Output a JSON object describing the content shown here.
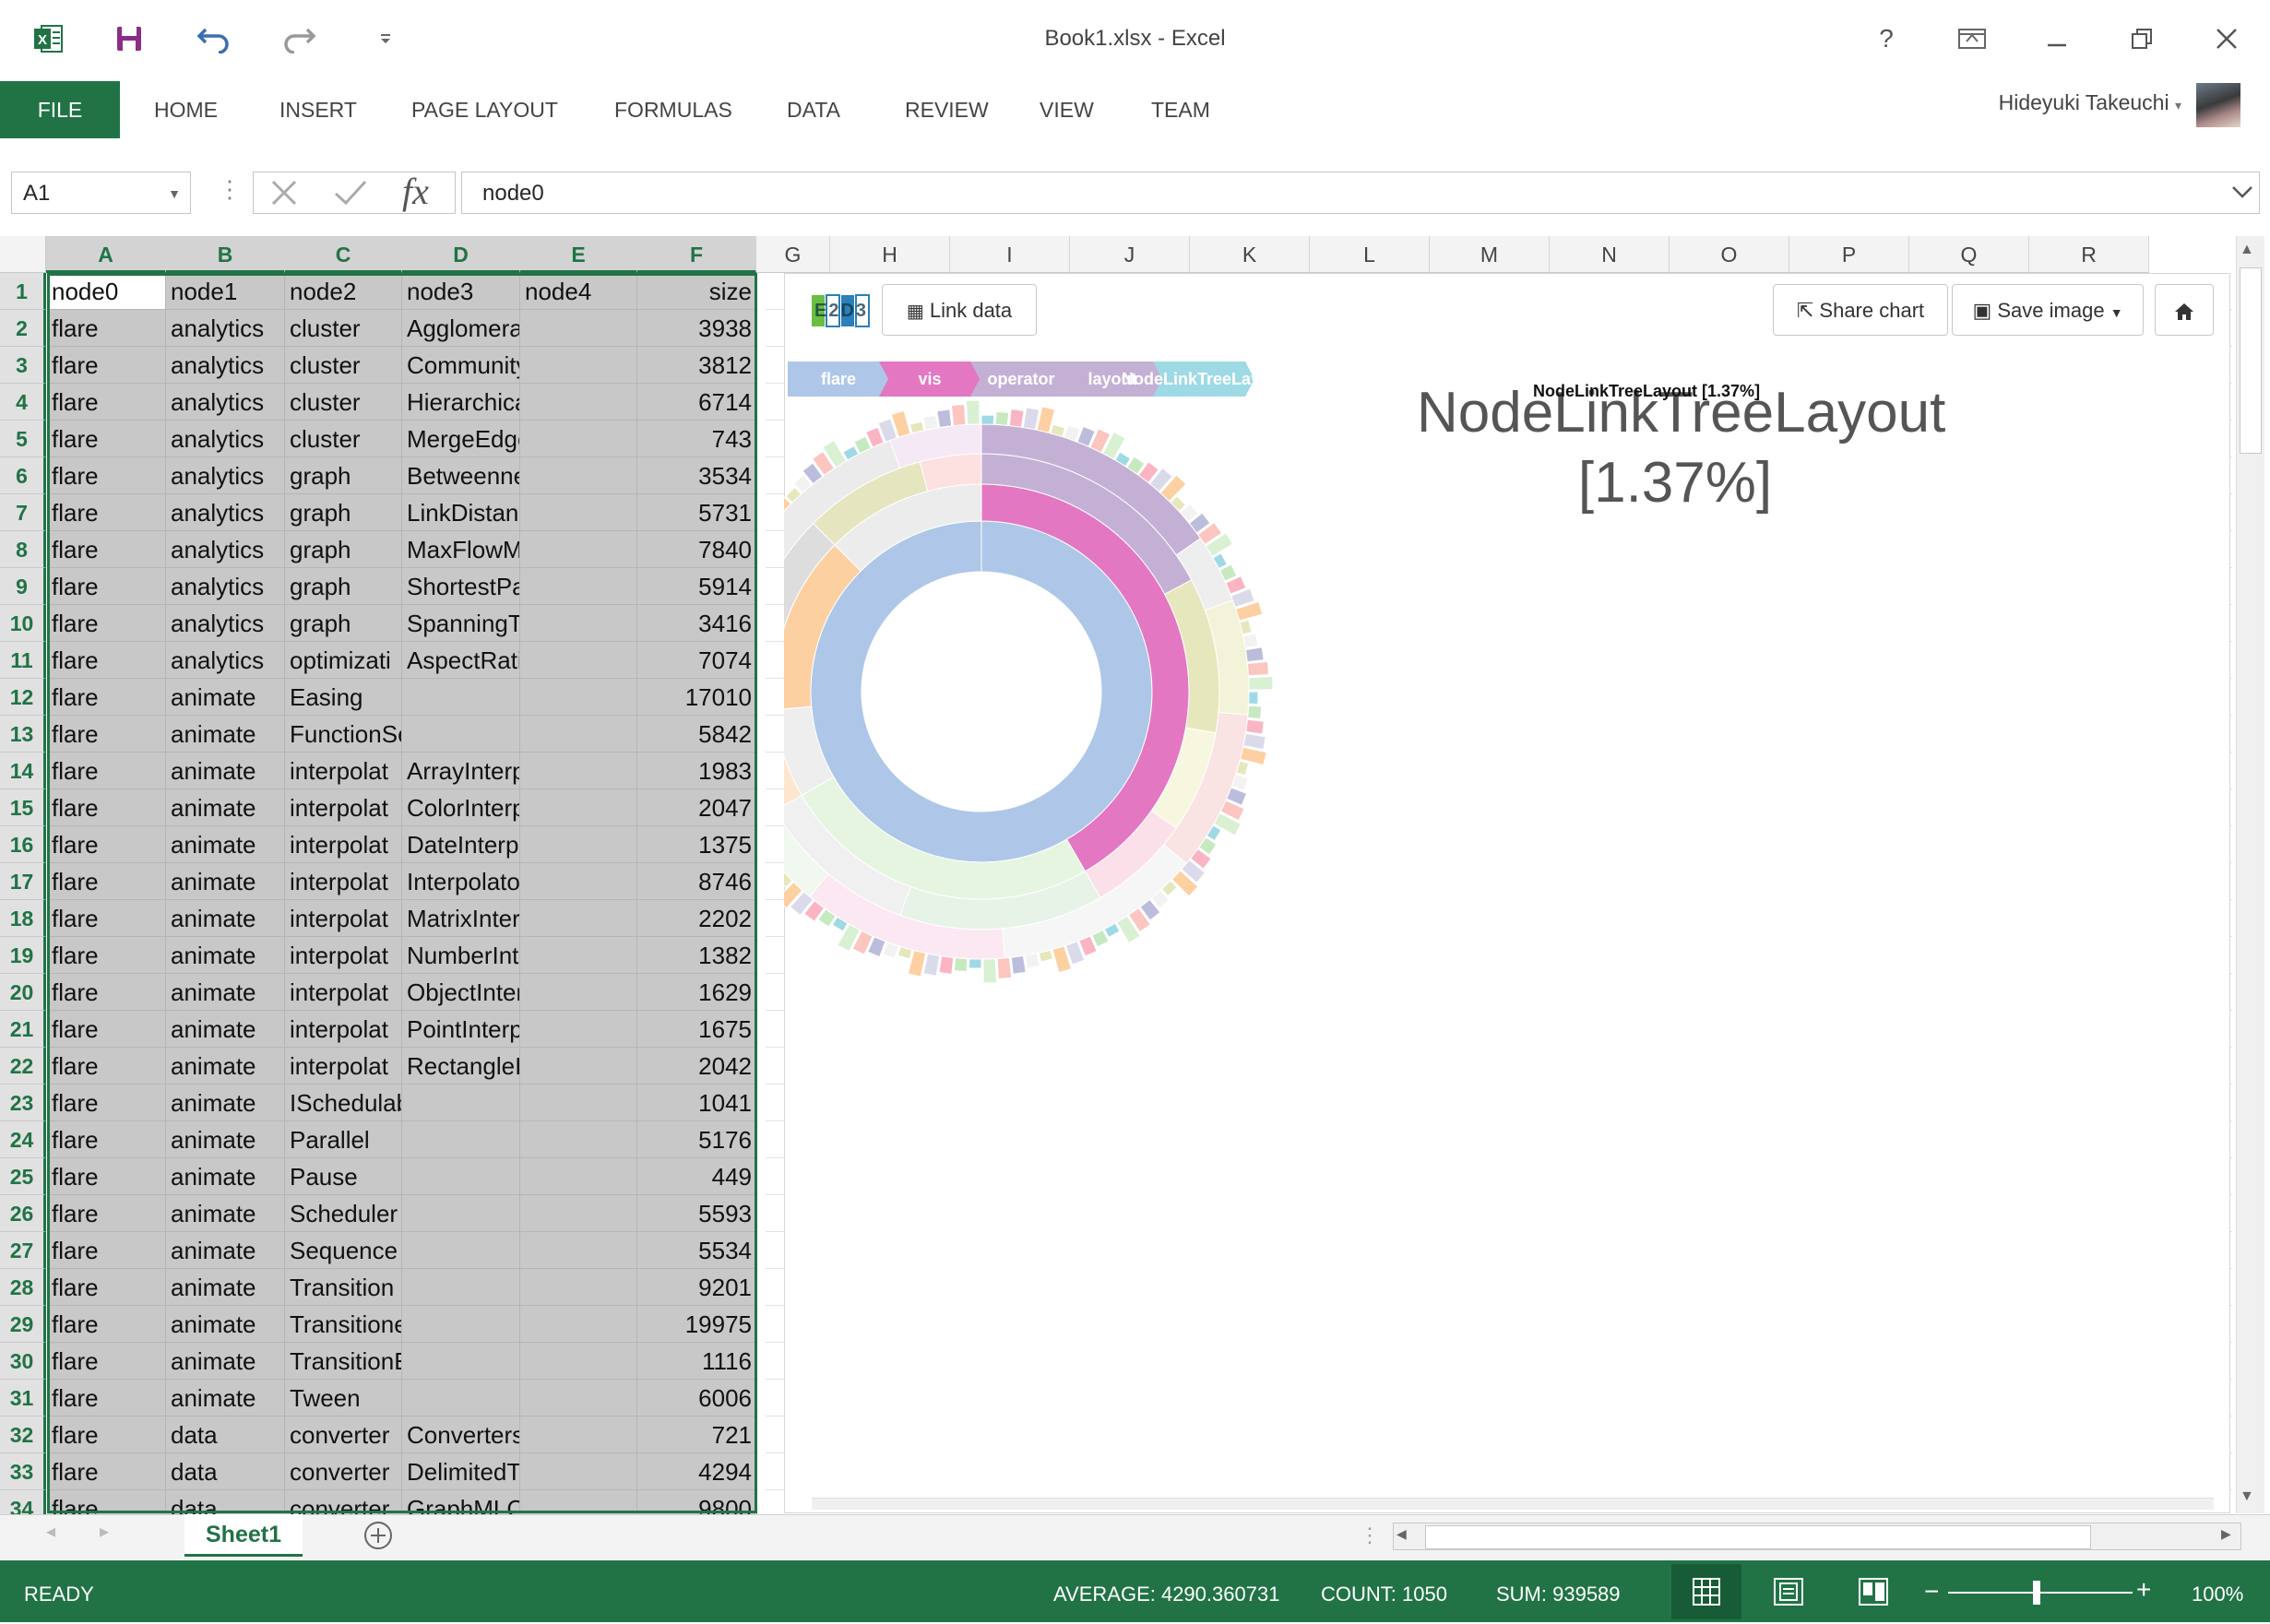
{
  "window": {
    "title": "Book1.xlsx - Excel",
    "user": "Hideyuki Takeuchi",
    "help": "?"
  },
  "ribbon": {
    "tabs": [
      "FILE",
      "HOME",
      "INSERT",
      "PAGE LAYOUT",
      "FORMULAS",
      "DATA",
      "REVIEW",
      "VIEW",
      "TEAM"
    ]
  },
  "formula_bar": {
    "name_box": "A1",
    "value": "node0"
  },
  "columns": [
    "A",
    "B",
    "C",
    "D",
    "E",
    "F",
    "G",
    "H",
    "I",
    "J",
    "K",
    "L",
    "M",
    "N",
    "O",
    "P",
    "Q",
    "R"
  ],
  "rows": [
    {
      "n": "1",
      "a": "node0",
      "b": "node1",
      "c": "node2",
      "d": "node3",
      "e": "node4",
      "f": "size"
    },
    {
      "n": "2",
      "a": "flare",
      "b": "analytics",
      "c": "cluster",
      "d": "AgglomerativeCluste",
      "e": "",
      "f": "3938"
    },
    {
      "n": "3",
      "a": "flare",
      "b": "analytics",
      "c": "cluster",
      "d": "CommunityStructure",
      "e": "",
      "f": "3812"
    },
    {
      "n": "4",
      "a": "flare",
      "b": "analytics",
      "c": "cluster",
      "d": "HierarchicalCluster",
      "e": "",
      "f": "6714"
    },
    {
      "n": "5",
      "a": "flare",
      "b": "analytics",
      "c": "cluster",
      "d": "MergeEdge",
      "e": "",
      "f": "743"
    },
    {
      "n": "6",
      "a": "flare",
      "b": "analytics",
      "c": "graph",
      "d": "BetweennessCentra",
      "e": "",
      "f": "3534"
    },
    {
      "n": "7",
      "a": "flare",
      "b": "analytics",
      "c": "graph",
      "d": "LinkDistance",
      "e": "",
      "f": "5731"
    },
    {
      "n": "8",
      "a": "flare",
      "b": "analytics",
      "c": "graph",
      "d": "MaxFlowMinCut",
      "e": "",
      "f": "7840"
    },
    {
      "n": "9",
      "a": "flare",
      "b": "analytics",
      "c": "graph",
      "d": "ShortestPaths",
      "e": "",
      "f": "5914"
    },
    {
      "n": "10",
      "a": "flare",
      "b": "analytics",
      "c": "graph",
      "d": "SpanningTree",
      "e": "",
      "f": "3416"
    },
    {
      "n": "11",
      "a": "flare",
      "b": "analytics",
      "c": "optimizati",
      "d": "AspectRatioBanker",
      "e": "",
      "f": "7074"
    },
    {
      "n": "12",
      "a": "flare",
      "b": "animate",
      "c": "Easing",
      "d": "",
      "e": "",
      "f": "17010"
    },
    {
      "n": "13",
      "a": "flare",
      "b": "animate",
      "c": "FunctionSequence",
      "d": "",
      "e": "",
      "f": "5842"
    },
    {
      "n": "14",
      "a": "flare",
      "b": "animate",
      "c": "interpolat",
      "d": "ArrayInterpolator",
      "e": "",
      "f": "1983"
    },
    {
      "n": "15",
      "a": "flare",
      "b": "animate",
      "c": "interpolat",
      "d": "ColorInterpolator",
      "e": "",
      "f": "2047"
    },
    {
      "n": "16",
      "a": "flare",
      "b": "animate",
      "c": "interpolat",
      "d": "DateInterpolator",
      "e": "",
      "f": "1375"
    },
    {
      "n": "17",
      "a": "flare",
      "b": "animate",
      "c": "interpolat",
      "d": "Interpolator",
      "e": "",
      "f": "8746"
    },
    {
      "n": "18",
      "a": "flare",
      "b": "animate",
      "c": "interpolat",
      "d": "MatrixInterpolator",
      "e": "",
      "f": "2202"
    },
    {
      "n": "19",
      "a": "flare",
      "b": "animate",
      "c": "interpolat",
      "d": "NumberInterpolator",
      "e": "",
      "f": "1382"
    },
    {
      "n": "20",
      "a": "flare",
      "b": "animate",
      "c": "interpolat",
      "d": "ObjectInterpolator",
      "e": "",
      "f": "1629"
    },
    {
      "n": "21",
      "a": "flare",
      "b": "animate",
      "c": "interpolat",
      "d": "PointInterpolator",
      "e": "",
      "f": "1675"
    },
    {
      "n": "22",
      "a": "flare",
      "b": "animate",
      "c": "interpolat",
      "d": "RectangleInterpolat",
      "e": "",
      "f": "2042"
    },
    {
      "n": "23",
      "a": "flare",
      "b": "animate",
      "c": "ISchedulable",
      "d": "",
      "e": "",
      "f": "1041"
    },
    {
      "n": "24",
      "a": "flare",
      "b": "animate",
      "c": "Parallel",
      "d": "",
      "e": "",
      "f": "5176"
    },
    {
      "n": "25",
      "a": "flare",
      "b": "animate",
      "c": "Pause",
      "d": "",
      "e": "",
      "f": "449"
    },
    {
      "n": "26",
      "a": "flare",
      "b": "animate",
      "c": "Scheduler",
      "d": "",
      "e": "",
      "f": "5593"
    },
    {
      "n": "27",
      "a": "flare",
      "b": "animate",
      "c": "Sequence",
      "d": "",
      "e": "",
      "f": "5534"
    },
    {
      "n": "28",
      "a": "flare",
      "b": "animate",
      "c": "Transition",
      "d": "",
      "e": "",
      "f": "9201"
    },
    {
      "n": "29",
      "a": "flare",
      "b": "animate",
      "c": "Transitioner",
      "d": "",
      "e": "",
      "f": "19975"
    },
    {
      "n": "30",
      "a": "flare",
      "b": "animate",
      "c": "TransitionEvent",
      "d": "",
      "e": "",
      "f": "1116"
    },
    {
      "n": "31",
      "a": "flare",
      "b": "animate",
      "c": "Tween",
      "d": "",
      "e": "",
      "f": "6006"
    },
    {
      "n": "32",
      "a": "flare",
      "b": "data",
      "c": "converter",
      "d": "Converters",
      "e": "",
      "f": "721"
    },
    {
      "n": "33",
      "a": "flare",
      "b": "data",
      "c": "converter",
      "d": "DelimitedTextConve",
      "e": "",
      "f": "4294"
    },
    {
      "n": "34",
      "a": "flare",
      "b": "data",
      "c": "converter",
      "d": "GraphMLConverter",
      "e": "",
      "f": "9800"
    }
  ],
  "chart_panel": {
    "logo": "E2D3",
    "link_data": "Link data",
    "share_chart": "Share chart",
    "save_image": "Save image",
    "breadcrumbs": [
      "flare",
      "vis",
      "operator",
      "layout",
      "NodeLinkTreeLayout"
    ],
    "breadcrumb_pct": "NodeLinkTreeLayout [1.37%]",
    "focus_line1": "NodeLinkTreeLayout",
    "focus_line2": "[1.37%]",
    "breadcrumb_colors": [
      "#aec7e8",
      "#e377c2",
      "#c5b0d5",
      "#c5b0d5",
      "#9edae5"
    ]
  },
  "sheet_tabs": {
    "active": "Sheet1"
  },
  "status_bar": {
    "ready": "READY",
    "average": "AVERAGE: 4290.360731",
    "count": "COUNT: 1050",
    "sum": "SUM: 939589",
    "zoom": "100%"
  },
  "colors": {
    "excel_green": "#217346"
  }
}
